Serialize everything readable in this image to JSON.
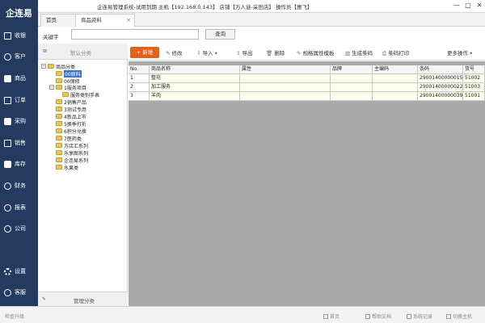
{
  "app": {
    "logo": "企连易",
    "title": "企连易管理系统-试用到期 主机【192.168.0.143】 店铺【万人谜-采田店】 操作员【惠飞】"
  },
  "window": {
    "minimize": "—",
    "maximize": "□",
    "close": "✕"
  },
  "tabs": [
    {
      "label": "首页"
    },
    {
      "label": "商品资料",
      "close": "×"
    }
  ],
  "nav": [
    {
      "label": "收银",
      "icon": "cashier-icon"
    },
    {
      "label": "客户",
      "icon": "customer-icon"
    },
    {
      "label": "商品",
      "icon": "product-icon"
    },
    {
      "label": "订单",
      "icon": "order-icon"
    },
    {
      "label": "采购",
      "icon": "purchase-icon"
    },
    {
      "label": "销售",
      "icon": "sales-icon"
    },
    {
      "label": "库存",
      "icon": "inventory-icon"
    },
    {
      "label": "财务",
      "icon": "finance-icon"
    },
    {
      "label": "报表",
      "icon": "report-icon"
    },
    {
      "label": "公司",
      "icon": "company-icon"
    },
    {
      "label": "设置",
      "icon": "gear-icon"
    },
    {
      "label": "客服",
      "icon": "service-icon"
    }
  ],
  "search": {
    "label": "关键字",
    "value": "",
    "button": "查询"
  },
  "tree": {
    "header": "默认分类",
    "footer": "管理分类",
    "root": "商品分类",
    "nodes": [
      "00原料",
      "00保修",
      "1服务项目",
      "服务类别手表",
      "2销售产品",
      "3测试专用",
      "4新品上市",
      "5换季打折",
      "6积分兑换",
      "7医药类",
      "万店汇系列",
      "乐享图系列",
      "企连易系列",
      "水果类"
    ]
  },
  "toolbar": {
    "add": "+ 新增",
    "edit": "修改",
    "import": "导入",
    "export": "导出",
    "delete": "删除",
    "template": "规格属性模板",
    "barcode": "生成条码",
    "print": "条码打印",
    "more": "更多操作"
  },
  "grid": {
    "columns": [
      "No.",
      "商品名称",
      "属性",
      "品牌",
      "主编码",
      "条码",
      "货号"
    ],
    "rows": [
      [
        "1",
        "整花",
        "",
        "",
        "",
        "29001400000015",
        "51002"
      ],
      [
        "2",
        "加工服务",
        "",
        "",
        "",
        "29001400000022",
        "51003"
      ],
      [
        "3",
        "羊肉",
        "",
        "",
        "",
        "29001400000039",
        "51001"
      ]
    ]
  },
  "status": {
    "left": "检查升级",
    "home": "首页",
    "help": "帮助文档",
    "log": "系统记录",
    "switch": "切换主机"
  },
  "colors": {
    "sidebar": "#243a5e",
    "accent": "#e0601c",
    "selected": "#3b74c4"
  }
}
